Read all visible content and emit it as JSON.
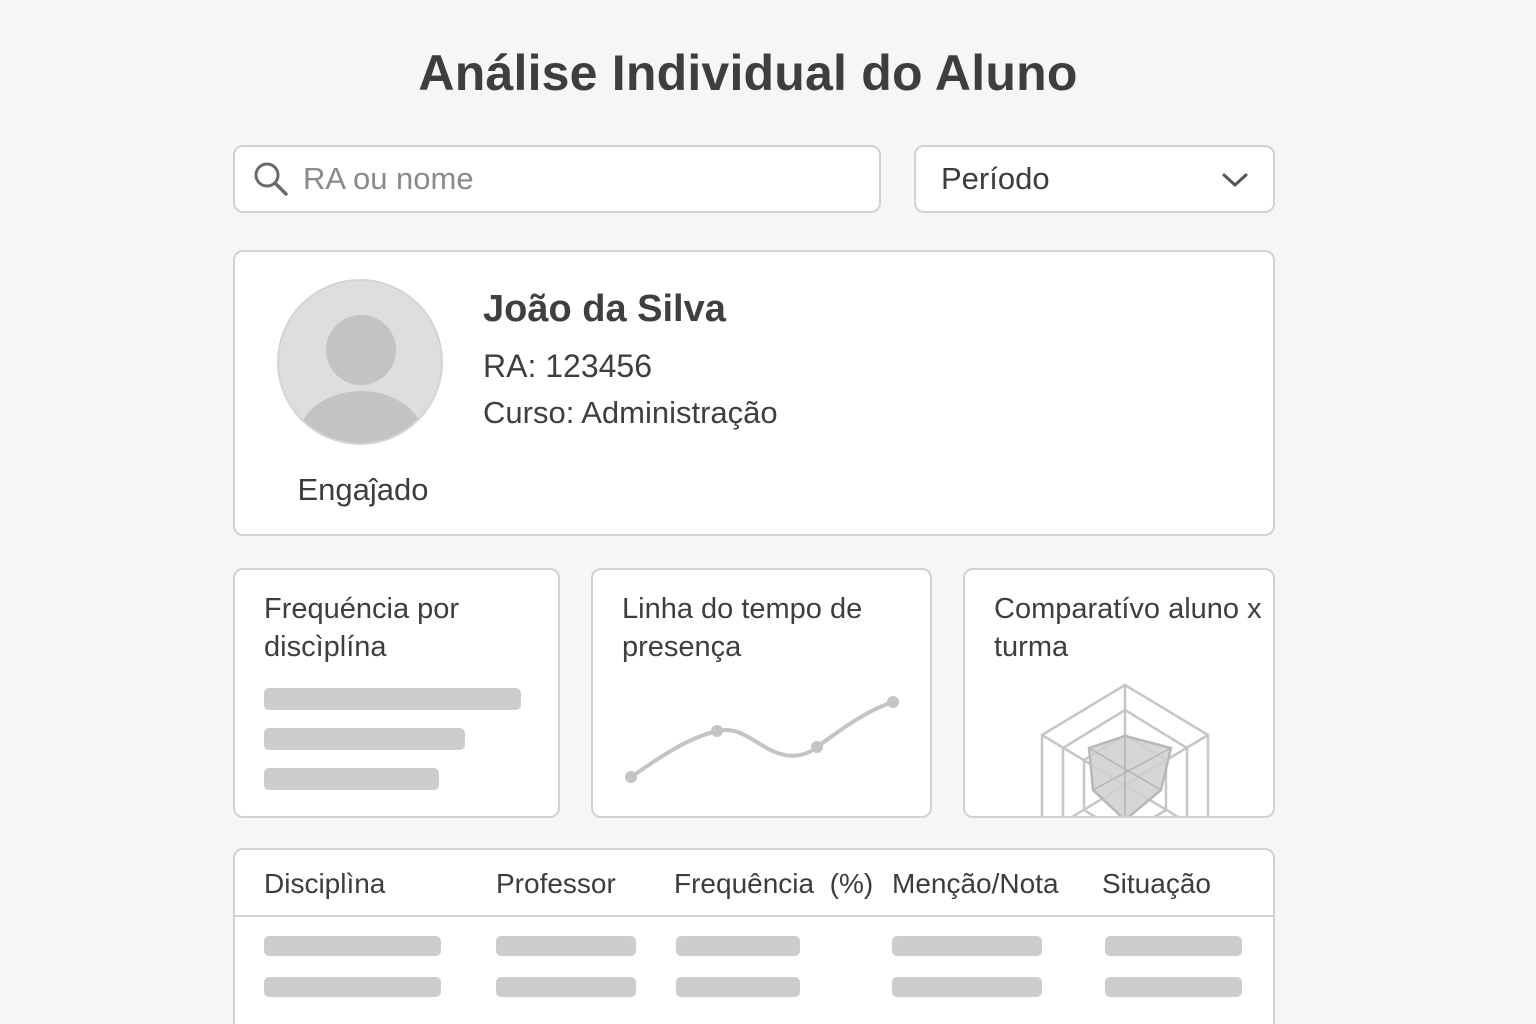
{
  "header": {
    "title": "Análise Individual do Aluno"
  },
  "search": {
    "placeholder": "RA ou nome",
    "icon": "search-icon"
  },
  "period_select": {
    "label": "Período",
    "icon": "chevron-down-icon"
  },
  "student": {
    "name": "João da Silva",
    "ra": "RA: 123456",
    "course": "Curso: Administração",
    "status": "Engaĵado"
  },
  "cards": [
    {
      "title": "Frequéncia por discìplína"
    },
    {
      "title": "Linha do tempo de presença"
    },
    {
      "title": "Comparatívo aluno x turma"
    }
  ],
  "table": {
    "columns": [
      "Disciplìna",
      "Professor",
      "Frequência  (%)",
      "Menção/Nota",
      "Situação"
    ]
  },
  "colors": {
    "background": "#f6f6f6",
    "border": "#d2d2d2",
    "placeholder_bar": "#cdcdcd",
    "text": "#3f3f3f"
  }
}
